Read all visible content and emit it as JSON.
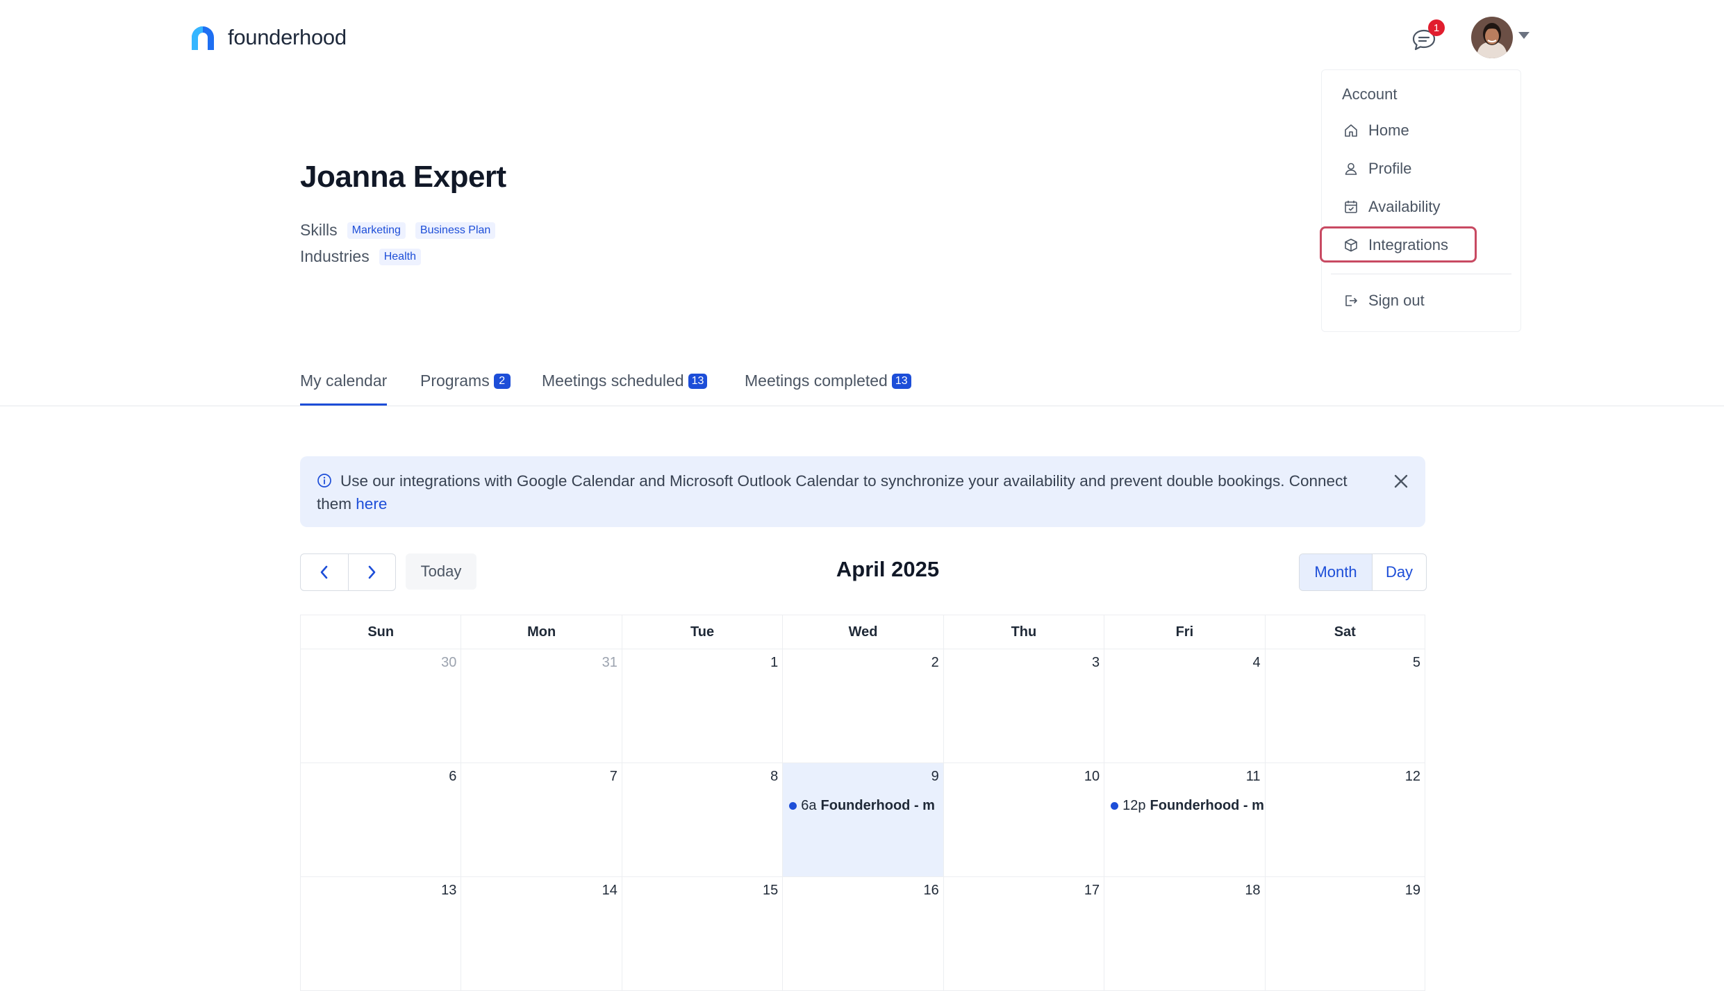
{
  "header": {
    "brand": "founderhood",
    "notification_count": "1"
  },
  "account_menu": {
    "heading": "Account",
    "items": [
      {
        "label": "Home",
        "icon": "home-icon"
      },
      {
        "label": "Profile",
        "icon": "user-icon"
      },
      {
        "label": "Availability",
        "icon": "calendar-check-icon"
      },
      {
        "label": "Integrations",
        "icon": "cube-icon",
        "highlighted": true
      },
      {
        "label": "Sign out",
        "icon": "sign-out-icon"
      }
    ]
  },
  "profile": {
    "name": "Joanna Expert",
    "skills_label": "Skills",
    "skills": [
      "Marketing",
      "Business Plan"
    ],
    "industries_label": "Industries",
    "industries": [
      "Health"
    ]
  },
  "tabs": [
    {
      "label": "My calendar",
      "count": null,
      "active": true
    },
    {
      "label": "Programs",
      "count": "2"
    },
    {
      "label": "Meetings scheduled",
      "count": "13"
    },
    {
      "label": "Meetings completed",
      "count": "13"
    }
  ],
  "banner": {
    "text": "Use our integrations with Google Calendar and Microsoft Outlook Calendar to synchronize your availability and prevent double bookings. Connect them",
    "link": "here"
  },
  "calendar": {
    "today_label": "Today",
    "title": "April 2025",
    "views": [
      "Month",
      "Day"
    ],
    "active_view": "Month",
    "weekdays": [
      "Sun",
      "Mon",
      "Tue",
      "Wed",
      "Thu",
      "Fri",
      "Sat"
    ],
    "weeks": [
      [
        {
          "d": "30",
          "muted": true
        },
        {
          "d": "31",
          "muted": true
        },
        {
          "d": "1"
        },
        {
          "d": "2"
        },
        {
          "d": "3"
        },
        {
          "d": "4"
        },
        {
          "d": "5"
        }
      ],
      [
        {
          "d": "6"
        },
        {
          "d": "7"
        },
        {
          "d": "8"
        },
        {
          "d": "9",
          "today": true,
          "event": {
            "time": "6a",
            "title": "Founderhood - m"
          }
        },
        {
          "d": "10"
        },
        {
          "d": "11",
          "event": {
            "time": "12p",
            "title": "Founderhood - m"
          }
        },
        {
          "d": "12"
        }
      ],
      [
        {
          "d": "13"
        },
        {
          "d": "14"
        },
        {
          "d": "15"
        },
        {
          "d": "16"
        },
        {
          "d": "17"
        },
        {
          "d": "18"
        },
        {
          "d": "19"
        }
      ]
    ]
  },
  "colors": {
    "primary": "#1d4ed8",
    "badge_red": "#e11d2e",
    "highlight_outline": "#c84a62",
    "banner_bg": "#eaf0fd"
  }
}
